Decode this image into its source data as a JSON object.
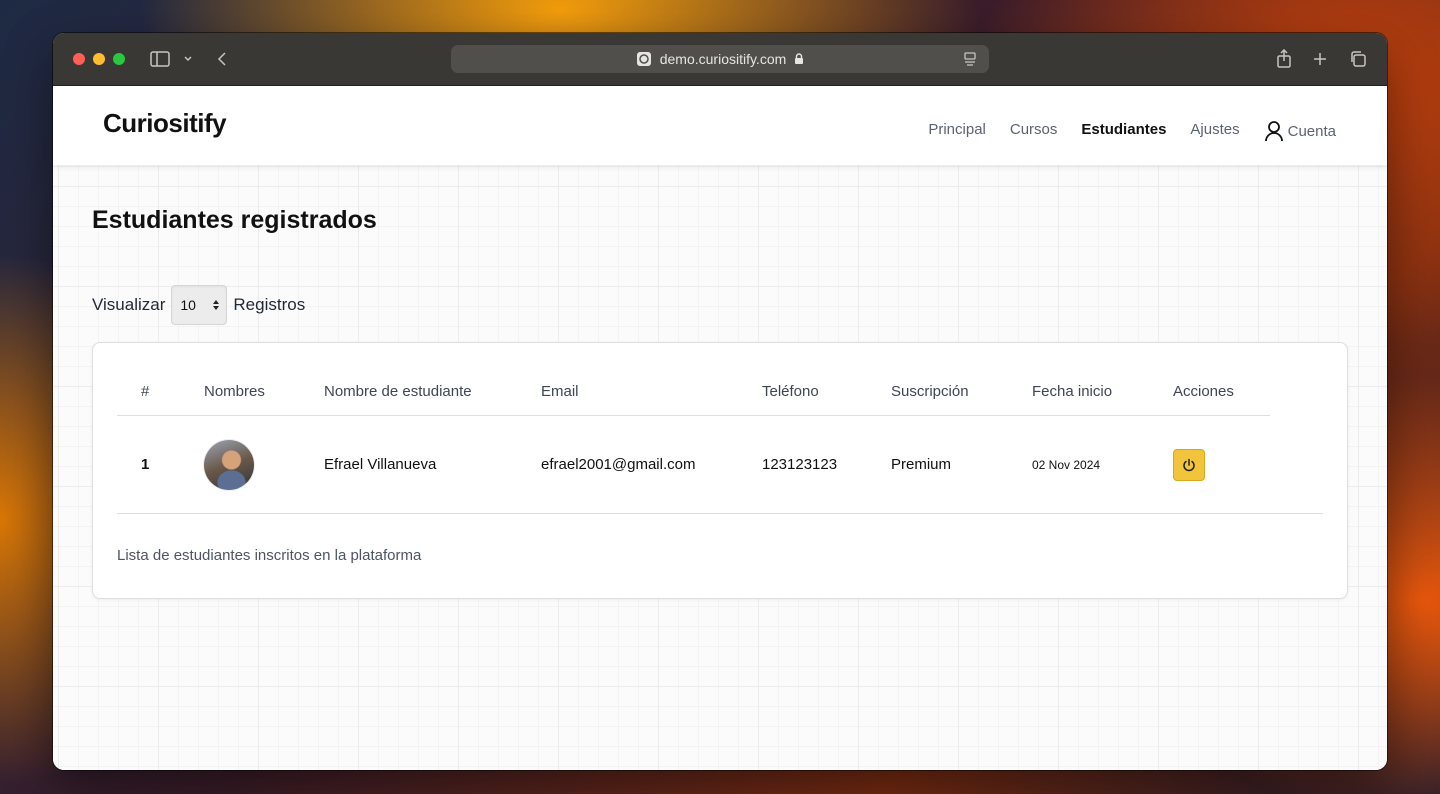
{
  "browser": {
    "url": "demo.curiositify.com"
  },
  "nav": {
    "logo": "Curiositify",
    "links": [
      "Principal",
      "Cursos",
      "Estudiantes",
      "Ajustes"
    ],
    "active": "Estudiantes",
    "account_label": "Cuenta"
  },
  "page": {
    "title": "Estudiantes registrados",
    "length_prefix": "Visualizar",
    "length_value": "10",
    "length_suffix": "Registros"
  },
  "table": {
    "headers": [
      "#",
      "Nombres",
      "Nombre de estudiante",
      "Email",
      "Teléfono",
      "Suscripción",
      "Fecha inicio",
      "Acciones"
    ],
    "rows": [
      {
        "num": "1",
        "name": "Efrael Villanueva",
        "email": "efrael2001@gmail.com",
        "phone": "123123123",
        "subscription": "Premium",
        "start_date": "02 Nov 2024",
        "action_icon": "power-icon"
      }
    ],
    "caption": "Lista de estudiantes inscritos en la plataforma"
  },
  "colors": {
    "accent_button": "#f2c43c",
    "titlebar": "#3a3835"
  }
}
